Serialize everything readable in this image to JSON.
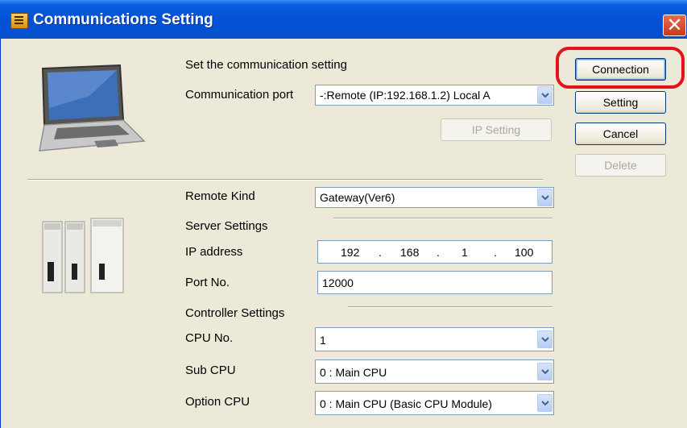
{
  "window": {
    "title": "Communications Setting",
    "close_symbol": "✕"
  },
  "connection_section": {
    "heading": "Set the communication setting",
    "port_label": "Communication port",
    "port_value": "-:Remote  (IP:192.168.1.2) Local A",
    "ip_setting_button": "IP Setting"
  },
  "remote_section": {
    "remote_kind_label": "Remote Kind",
    "remote_kind_value": "Gateway(Ver6)",
    "server_settings_heading": "Server Settings",
    "ip_label": "IP address",
    "ip_parts": [
      "192",
      "168",
      "1",
      "100"
    ],
    "port_no_label": "Port No.",
    "port_no_value": "12000",
    "controller_settings_heading": "Controller Settings",
    "cpu_no_label": "CPU No.",
    "cpu_no_value": "1",
    "sub_cpu_label": "Sub CPU",
    "sub_cpu_value": "0 : Main CPU",
    "option_cpu_label": "Option CPU",
    "option_cpu_value": "0 : Main CPU (Basic CPU Module)"
  },
  "buttons": {
    "connection": "Connection",
    "setting": "Setting",
    "cancel": "Cancel",
    "delete": "Delete"
  },
  "colors": {
    "title_bar": "#0454d8",
    "highlight": "#e5121c",
    "dialog_bg": "#ece9d8"
  }
}
